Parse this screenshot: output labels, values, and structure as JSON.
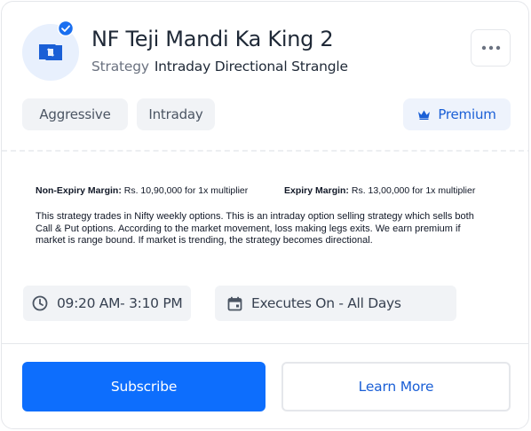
{
  "strategy": {
    "name": "NF Teji Mandi Ka King 2",
    "type_label": "Strategy",
    "type_value": "Intraday Directional Strangle"
  },
  "tags": [
    "Aggressive",
    "Intraday"
  ],
  "premium_label": "Premium",
  "margins": {
    "non_expiry_label": "Non-Expiry Margin:",
    "non_expiry_value": " Rs. 10,90,000 for 1x multiplier",
    "expiry_label": "Expiry Margin:",
    "expiry_value": " Rs. 13,00,000 for 1x multiplier"
  },
  "description": "This strategy trades in Nifty weekly options. This is an intraday option selling strategy which sells both Call & Put options. According to the market movement, loss making legs exits. We earn premium if market is range bound. If market is trending, the strategy becomes directional.",
  "schedule": {
    "time": "09:20 AM- 3:10 PM",
    "executes": "Executes On - All Days"
  },
  "buttons": {
    "subscribe": "Subscribe",
    "learn_more": "Learn More"
  },
  "colors": {
    "primary": "#0d6efd",
    "accent_text": "#1a5fd6",
    "tag_bg": "#f1f3f6"
  },
  "icons": [
    "strategy-logo-icon",
    "verified-badge-icon",
    "more-options-icon",
    "crown-icon",
    "clock-icon",
    "calendar-icon"
  ]
}
